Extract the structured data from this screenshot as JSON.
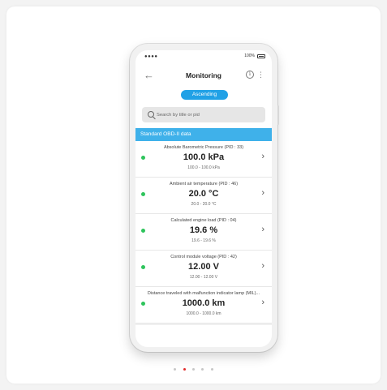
{
  "status_bar": {
    "signal": "●●●●",
    "battery": "100%"
  },
  "header": {
    "title": "Monitoring",
    "back_glyph": "←",
    "info_glyph": "i",
    "menu_glyph": "⋮"
  },
  "sort_button": {
    "label": "Ascending"
  },
  "search": {
    "placeholder": "Search by title or pid"
  },
  "section": {
    "title": "Standard OBD-II data"
  },
  "items": [
    {
      "label": "Absolute Barometric Pressure (PID : 33)",
      "value": "100.0 kPa",
      "range": "100.0 - 100.0 kPa"
    },
    {
      "label": "Ambient air temperature (PID : 46)",
      "value": "20.0 °C",
      "range": "20.0 - 20.0 °C"
    },
    {
      "label": "Calculated engine load (PID : 04)",
      "value": "19.6 %",
      "range": "19.6 - 19.6 %"
    },
    {
      "label": "Control module voltage (PID : 42)",
      "value": "12.00 V",
      "range": "12.00 - 12.00 V"
    },
    {
      "label": "Distance traveled with malfunction indicator lamp (MIL)...",
      "value": "1000.0 km",
      "range": "1000.0 - 1000.0 km"
    }
  ],
  "colors": {
    "accent": "#21a1e6",
    "section": "#3fb1ea",
    "ok_dot": "#2ec45c",
    "active_page": "#e22a2a"
  }
}
